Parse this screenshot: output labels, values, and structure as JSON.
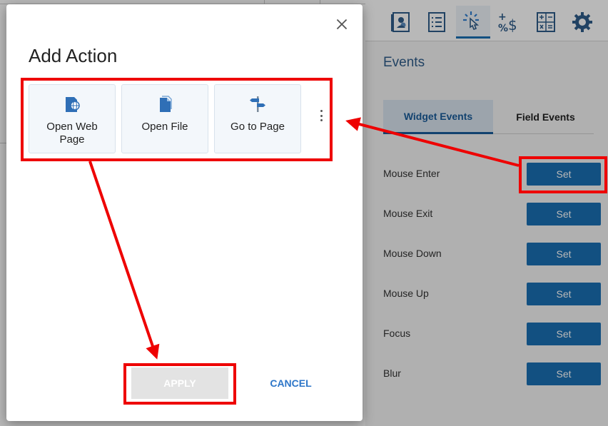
{
  "modal": {
    "title": "Add Action",
    "actions": [
      {
        "label": "Open Web Page"
      },
      {
        "label": "Open File"
      },
      {
        "label": "Go to Page"
      }
    ],
    "apply_label": "APPLY",
    "cancel_label": "CANCEL"
  },
  "panel": {
    "title": "Events",
    "tabs": [
      "Widget Events",
      "Field Events"
    ],
    "events": [
      {
        "label": "Mouse Enter",
        "button": "Set"
      },
      {
        "label": "Mouse Exit",
        "button": "Set"
      },
      {
        "label": "Mouse Down",
        "button": "Set"
      },
      {
        "label": "Mouse Up",
        "button": "Set"
      },
      {
        "label": "Focus",
        "button": "Set"
      },
      {
        "label": "Blur",
        "button": "Set"
      }
    ]
  },
  "toolbar": {
    "icons": [
      "contact-card-icon",
      "checklist-icon",
      "click-events-icon",
      "calculation-icon",
      "calculator-icon",
      "gear-icon"
    ]
  },
  "colors": {
    "accent": "#1a6fb3",
    "annotation": "#ee0000",
    "cancel": "#2d76c8",
    "title": "#2e5c8a"
  }
}
